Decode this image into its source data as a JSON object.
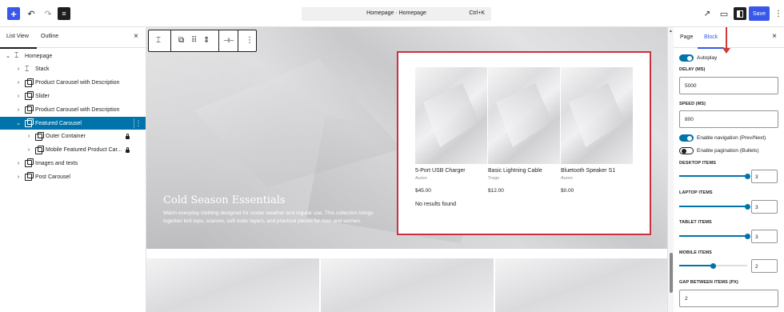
{
  "toolbar": {
    "add_icon": "+",
    "undo_icon": "↶",
    "redo_icon": "↷",
    "list_icon": "≡",
    "command_title": "Homepage · Homepage",
    "command_shortcut": "Ctrl+K",
    "external_icon": "↗",
    "device_icon": "▭",
    "save_label": "Save",
    "more_icon": "⋮"
  },
  "left_panel": {
    "tabs": [
      "List View",
      "Outline"
    ],
    "close_icon": "×",
    "tree": [
      {
        "label": "Homepage",
        "icon": "stack-icon",
        "chevron": "⌄",
        "selected": false,
        "locked": false
      },
      {
        "label": "Stack",
        "icon": "stack-icon",
        "chevron": "›",
        "selected": false,
        "locked": false
      },
      {
        "label": "Product Carousel with Description",
        "icon": "copy-icon",
        "chevron": "›",
        "selected": false,
        "locked": false
      },
      {
        "label": "Slider",
        "icon": "copy-icon",
        "chevron": "›",
        "selected": false,
        "locked": false
      },
      {
        "label": "Product Carousel with Description",
        "icon": "copy-icon",
        "chevron": "›",
        "selected": false,
        "locked": false
      },
      {
        "label": "Featured Carousel",
        "icon": "copy-icon",
        "chevron": "⌄",
        "selected": true,
        "locked": false
      },
      {
        "label": "Outer Container",
        "icon": "copy-icon",
        "chevron": "›",
        "selected": false,
        "locked": true
      },
      {
        "label": "Mobile Featured Product Car...",
        "icon": "copy-icon",
        "chevron": "›",
        "selected": false,
        "locked": true
      },
      {
        "label": "Images and texts",
        "icon": "copy-icon",
        "chevron": "›",
        "selected": false,
        "locked": false
      },
      {
        "label": "Post Carousel",
        "icon": "copy-icon",
        "chevron": "›",
        "selected": false,
        "locked": false
      }
    ],
    "options_icon": "⋮"
  },
  "block_toolbar": {
    "icons": [
      "⌶",
      "⧉",
      "⠿",
      "⇕",
      "⊣⊢",
      "⋮"
    ]
  },
  "hero": {
    "title": "Cold Season Essentials",
    "description": "Warm everyday clothing designed for cooler weather and regular use. This collection brings together knit tops, scarves, soft outer layers, and practical pieces for men and women."
  },
  "products": [
    {
      "name": "5-Port USB Charger",
      "brand": "Auron",
      "price": "$45.00"
    },
    {
      "name": "Basic Lightning Cable",
      "brand": "Trego",
      "price": "$12.00"
    },
    {
      "name": "Bluetooth Speaker S1",
      "brand": "Auron",
      "price": "$0.00"
    }
  ],
  "no_results": "No results found",
  "right_panel": {
    "tabs": [
      "Page",
      "Block"
    ],
    "close_icon": "×",
    "autoplay_label": "Autoplay",
    "autoplay_on": true,
    "delay_label": "DELAY (MS)",
    "delay_value": "5000",
    "speed_label": "SPEED (MS)",
    "speed_value": "800",
    "nav_label": "Enable navigation (Prev/Next)",
    "nav_on": true,
    "pagination_label": "Enable pagination (Bullets)",
    "pagination_on": false,
    "desktop_label": "DESKTOP ITEMS",
    "desktop_value": "3",
    "desktop_fraction": 1.0,
    "laptop_label": "LAPTOP ITEMS",
    "laptop_value": "3",
    "laptop_fraction": 1.0,
    "tablet_label": "TABLET ITEMS",
    "tablet_value": "3",
    "tablet_fraction": 1.0,
    "mobile_label": "MOBILE ITEMS",
    "mobile_value": "2",
    "mobile_fraction": 0.5,
    "gap_label": "GAP BETWEEN ITEMS (PX)",
    "gap_value": "2"
  },
  "colors": {
    "accent": "#3858e9",
    "selection": "#0073aa",
    "annotation_red": "#d03a3a"
  }
}
